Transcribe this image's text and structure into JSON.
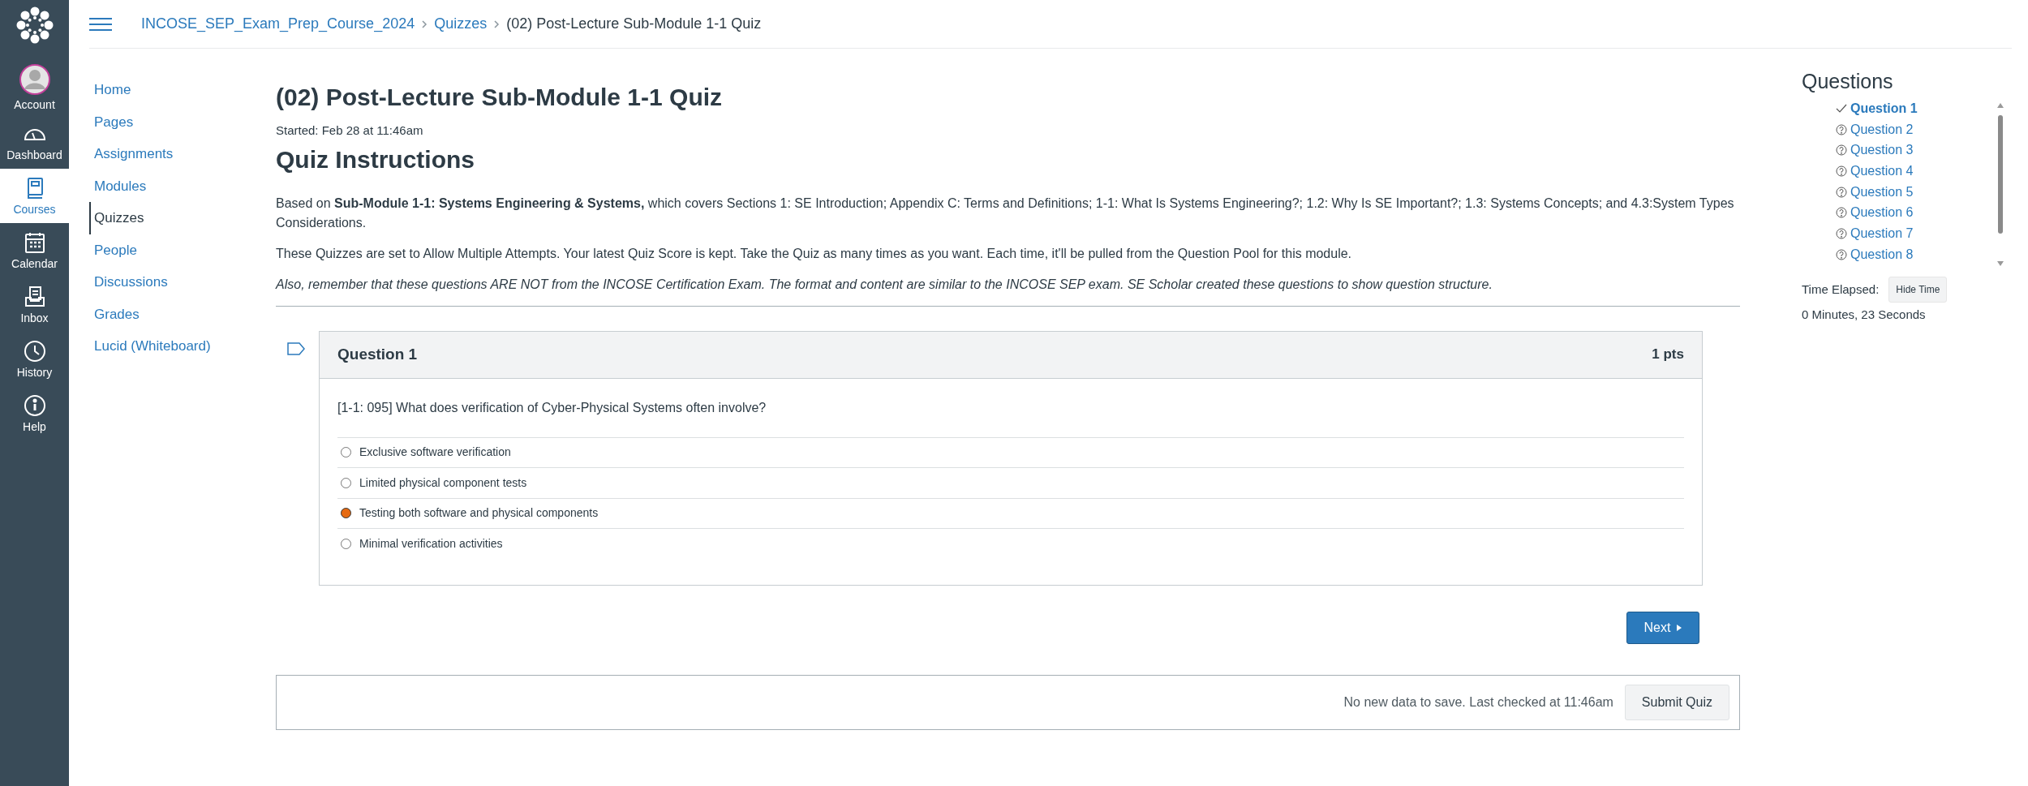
{
  "global_nav": [
    {
      "kind": "account",
      "label": "Account",
      "selected": false
    },
    {
      "kind": "dashboard",
      "label": "Dashboard",
      "selected": false
    },
    {
      "kind": "courses",
      "label": "Courses",
      "selected": true
    },
    {
      "kind": "calendar",
      "label": "Calendar",
      "selected": false
    },
    {
      "kind": "inbox",
      "label": "Inbox",
      "selected": false
    },
    {
      "kind": "history",
      "label": "History",
      "selected": false
    },
    {
      "kind": "help",
      "label": "Help",
      "selected": false
    }
  ],
  "breadcrumbs": [
    {
      "label": "INCOSE_SEP_Exam_Prep_Course_2024",
      "link": true
    },
    {
      "label": "Quizzes",
      "link": true
    },
    {
      "label": "(02) Post-Lecture Sub-Module 1-1 Quiz",
      "link": false
    }
  ],
  "course_nav": [
    {
      "label": "Home",
      "selected": false
    },
    {
      "label": "Pages",
      "selected": false
    },
    {
      "label": "Assignments",
      "selected": false
    },
    {
      "label": "Modules",
      "selected": false
    },
    {
      "label": "Quizzes",
      "selected": true
    },
    {
      "label": "People",
      "selected": false
    },
    {
      "label": "Discussions",
      "selected": false
    },
    {
      "label": "Grades",
      "selected": false
    },
    {
      "label": "Lucid (Whiteboard)",
      "selected": false
    }
  ],
  "quiz": {
    "title": "(02) Post-Lecture Sub-Module 1-1 Quiz",
    "started": "Started: Feb 28 at 11:46am",
    "instructions_heading": "Quiz Instructions",
    "paragraphs": [
      {
        "kind": "normal",
        "text": "Based on **Sub-Module 1-1: Systems Engineering & Systems,** which covers Sections 1: SE Introduction; Appendix C: Terms and Definitions; 1-1: What Is Systems Engineering?; 1.2: Why Is SE Important?; 1.3: Systems Concepts; and 4.3:System Types Considerations."
      },
      {
        "kind": "normal",
        "text": "These Quizzes are set to Allow Multiple Attempts. Your latest Quiz Score is kept. Take the Quiz as many times as you want. Each time, it'll be pulled from the Question Pool for this module."
      },
      {
        "kind": "italic",
        "text": "Also, remember that these questions ARE NOT from the INCOSE Certification Exam. The format and content are similar to the INCOSE SEP exam. SE Scholar created these questions to show question structure."
      }
    ],
    "question": {
      "title": "Question 1",
      "points": "1 pts",
      "text": "[1-1: 095] What does verification of Cyber-Physical Systems often involve?",
      "answers": [
        {
          "label": "Exclusive software verification",
          "selected": false
        },
        {
          "label": "Limited physical component tests",
          "selected": false
        },
        {
          "label": "Testing both software and physical components",
          "selected": true
        },
        {
          "label": "Minimal verification activities",
          "selected": false
        }
      ]
    },
    "next_button": "Next",
    "save_status": "No new data to save. Last checked at 11:46am",
    "submit_button": "Submit Quiz"
  },
  "sidebar": {
    "heading": "Questions",
    "questions": [
      {
        "label": "Question 1",
        "answered": true,
        "selected": true
      },
      {
        "label": "Question 2",
        "answered": false,
        "selected": false
      },
      {
        "label": "Question 3",
        "answered": false,
        "selected": false
      },
      {
        "label": "Question 4",
        "answered": false,
        "selected": false
      },
      {
        "label": "Question 5",
        "answered": false,
        "selected": false
      },
      {
        "label": "Question 6",
        "answered": false,
        "selected": false
      },
      {
        "label": "Question 7",
        "answered": false,
        "selected": false
      },
      {
        "label": "Question 8",
        "answered": false,
        "selected": false
      }
    ],
    "time_label": "Time Elapsed:",
    "hide_time_button": "Hide Time",
    "time_value": "0 Minutes, 23 Seconds"
  }
}
